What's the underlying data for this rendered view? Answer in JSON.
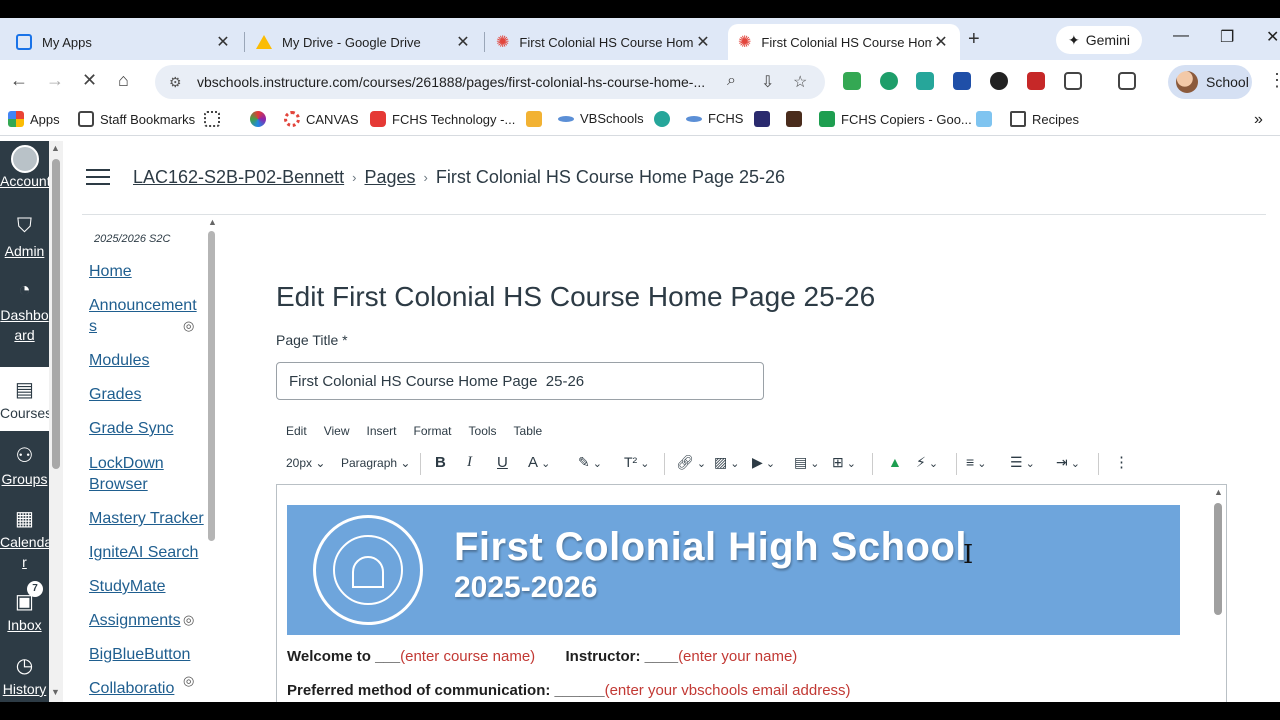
{
  "browser": {
    "tabs": [
      {
        "title": "My Apps",
        "active": false
      },
      {
        "title": "My Drive - Google Drive",
        "active": false
      },
      {
        "title": "First Colonial HS Course Home",
        "active": false
      },
      {
        "title": "First Colonial HS Course Home",
        "active": true
      }
    ],
    "gemini_label": "Gemini",
    "url": "vbschools.instructure.com/courses/261888/pages/first-colonial-hs-course-home-...",
    "profile_label": "School",
    "bookmarks": [
      "Apps",
      "Staff Bookmarks",
      "CANVAS",
      "FCHS Technology -...",
      "VBSchools",
      "FCHS",
      "FCHS Copiers - Goo...",
      "Recipes"
    ]
  },
  "global_nav": {
    "items": [
      {
        "label": "Account",
        "icon": "user-icon"
      },
      {
        "label": "Admin",
        "icon": "shield-icon"
      },
      {
        "label": "Dashbo ard",
        "icon": "speedometer-icon"
      },
      {
        "label": "Courses",
        "icon": "book-icon",
        "active": true
      },
      {
        "label": "Groups",
        "icon": "groups-icon"
      },
      {
        "label": "Calenda r",
        "icon": "calendar-icon"
      },
      {
        "label": "Inbox",
        "icon": "inbox-icon",
        "badge": "7"
      },
      {
        "label": "History",
        "icon": "clock-icon"
      }
    ]
  },
  "breadcrumb": {
    "course": "LAC162-S2B-P02-Bennett",
    "section": "Pages",
    "current": "First Colonial HS Course Home Page 25-26"
  },
  "course_nav": {
    "term": "2025/2026 S2C",
    "items": [
      {
        "label": "Home",
        "hidden": false
      },
      {
        "label": "Announcements",
        "hidden": true
      },
      {
        "label": "Modules",
        "hidden": false
      },
      {
        "label": "Grades",
        "hidden": false
      },
      {
        "label": "Grade Sync",
        "hidden": false
      },
      {
        "label": "LockDown Browser",
        "hidden": false
      },
      {
        "label": "Mastery Tracker",
        "hidden": false
      },
      {
        "label": "IgniteAI Search",
        "hidden": false
      },
      {
        "label": "StudyMate",
        "hidden": false
      },
      {
        "label": "Assignments",
        "hidden": true
      },
      {
        "label": "BigBlueButton",
        "hidden": false
      },
      {
        "label": "Collaboratio",
        "hidden": true
      }
    ]
  },
  "main": {
    "heading": "Edit First Colonial HS Course Home Page 25-26",
    "page_title_label": "Page Title",
    "required_mark": "*",
    "page_title_value": "First Colonial HS Course Home Page  25-26"
  },
  "editor": {
    "menu": [
      "Edit",
      "View",
      "Insert",
      "Format",
      "Tools",
      "Table"
    ],
    "font_size": "20px",
    "block_format": "Paragraph",
    "banner_title": "First Colonial High School",
    "banner_year": "2025-2026",
    "welcome_label": "Welcome to ___",
    "welcome_placeholder": "(enter course name)",
    "instructor_label": "Instructor: ____",
    "instructor_placeholder": "(enter your name)",
    "pref_label": "Preferred method of communication: ______",
    "pref_placeholder": "(enter your vbschools email address)"
  },
  "colors": {
    "canvas_nav": "#2d3b45",
    "link": "#1f5e8f",
    "banner": "#6ea5dc",
    "placeholder_red": "#c23934"
  }
}
